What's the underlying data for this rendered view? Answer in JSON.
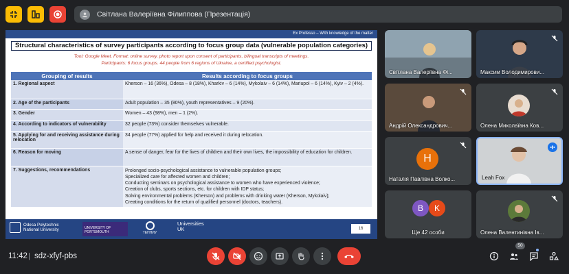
{
  "presenting": {
    "label": "Світлана Валеріївна Філиппова (Презентація)"
  },
  "slide": {
    "header_stripe": "Ex Professo – With knowledge of the matter",
    "title": "Structural characteristics of survey participants according to focus group data (vulnerable population categories)",
    "subtitle_line1": "Tool: Google Meet. Format: online survey, photo report upon consent of participants, bilingual transcripts of meetings.",
    "subtitle_line2": "Participants: 6 focus groups. 44 people from 6 regions of Ukraine, a certified psychologist.",
    "table_headers": [
      "Grouping of results",
      "Results according to focus groups"
    ],
    "rows": [
      {
        "k": "1. Regional aspect",
        "v": "Kherson – 16 (36%), Odesa – 8 (18%), Kharkiv – 6 (14%), Mykolaiv – 6 (14%), Mariupol – 6 (14%), Kyiv – 2 (4%)."
      },
      {
        "k": "2. Age of the participants",
        "v": "Adult population – 35 (80%), youth representatives – 9 (20%)."
      },
      {
        "k": "3. Gender",
        "v": "Women – 43 (98%), men – 1 (2%)."
      },
      {
        "k": "4. According to indicators of vulnerability",
        "v": "32 people (73%) consider themselves vulnerable."
      },
      {
        "k": "5. Applying for and receiving assistance during relocation",
        "v": "34 people (77%) applied for help and received it during relocation."
      },
      {
        "k": "6. Reason for moving",
        "v": "A sense of danger, fear for the lives of children and their own lives, the impossibility of education for children."
      },
      {
        "k": "7. Suggestions, recommendations",
        "v_lines": [
          "Prolonged socio-psychological assistance to vulnerable population groups;",
          "Specialized care for affected women and children;",
          "Conducting seminars on psychological assistance to women who have experienced violence;",
          "Creation of clubs, sports sections, etc. for children with IDP status;",
          "Solving environmental problems (Kherson) and problems with drinking water (Kherson, Mykolaiv);",
          "Creating conditions for the return of qualified personnel (doctors, teachers)."
        ]
      }
    ],
    "footer": {
      "uni1_line1": "Odesa Polytechnic",
      "uni1_line2": "National University",
      "uni2": "UNIVERSITY OF PORTSMOUTH",
      "uni3": "ТЕННИУ",
      "uni4_line1": "Universities",
      "uni4_line2": "UK",
      "page": "16"
    }
  },
  "participants": [
    {
      "name": "Світлана Валеріївна Фі...",
      "muted": false
    },
    {
      "name": "Максим Володимирови...",
      "muted": true
    },
    {
      "name": "Андрій Олександрович...",
      "muted": true
    },
    {
      "name": "Олена Миколаївна Ков...",
      "muted": true
    },
    {
      "name": "Наталія Павлівна Волко...",
      "muted": true,
      "initial": "Н",
      "color": "#e8710a"
    },
    {
      "name": "Leah Fox",
      "muted": false,
      "speaking": true
    },
    {
      "name": "Ще 42 особи",
      "initials": [
        "B",
        "K"
      ],
      "colors": [
        "#7e57c2",
        "#e64a19"
      ]
    },
    {
      "name": "Олена Валентинівна Ів...",
      "muted": true
    }
  ],
  "bottom": {
    "time": "11:42",
    "separator": "|",
    "meeting_code": "sdz-xfyf-pbs",
    "participant_count": "50"
  },
  "colors": {
    "background": "#202124",
    "danger": "#ea4335",
    "accent": "#fbbc04",
    "blue": "#1a73e8"
  }
}
